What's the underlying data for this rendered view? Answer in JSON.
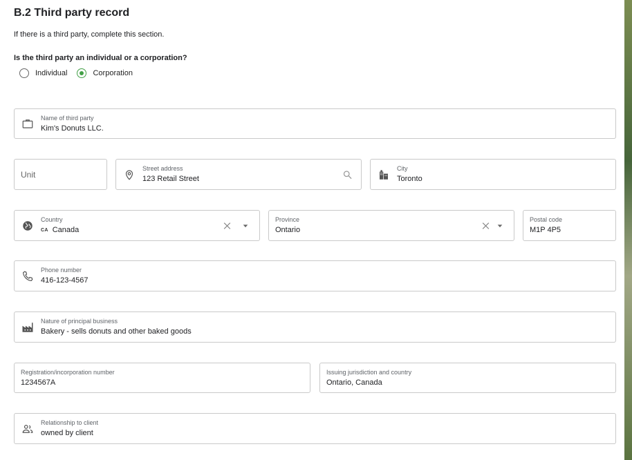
{
  "section": {
    "title": "B.2 Third party record",
    "subtitle": "If there is a third party, complete this section.",
    "question": "Is the third party an individual or a corporation?",
    "options": [
      {
        "label": "Individual",
        "selected": false
      },
      {
        "label": "Corporation",
        "selected": true
      }
    ],
    "accent_color": "#43a047"
  },
  "fields": {
    "name": {
      "label": "Name of third party",
      "value": "Kim's Donuts LLC.",
      "icon": "briefcase-icon"
    },
    "unit": {
      "placeholder": "Unit"
    },
    "street": {
      "label": "Street address",
      "value": "123 Retail Street",
      "icon": "location-pin-icon",
      "trailing_icon": "search-icon"
    },
    "city": {
      "label": "City",
      "value": "Toronto",
      "icon": "city-buildings-icon"
    },
    "country": {
      "label": "Country",
      "code": "CA",
      "value": "Canada",
      "icon": "globe-icon"
    },
    "province": {
      "label": "Province",
      "value": "Ontario"
    },
    "postal": {
      "label": "Postal code",
      "value": "M1P 4P5"
    },
    "phone": {
      "label": "Phone number",
      "value": "416-123-4567",
      "icon": "phone-icon"
    },
    "business": {
      "label": "Nature of principal business",
      "value": "Bakery - sells donuts and other baked goods",
      "icon": "factory-icon"
    },
    "registration": {
      "label": "Registration/incorporation number",
      "value": "1234567A"
    },
    "jurisdiction": {
      "label": "Issuing jurisdiction and country",
      "value": "Ontario, Canada"
    },
    "relationship": {
      "label": "Relationship to client",
      "value": "owned by client",
      "icon": "people-icon"
    }
  }
}
